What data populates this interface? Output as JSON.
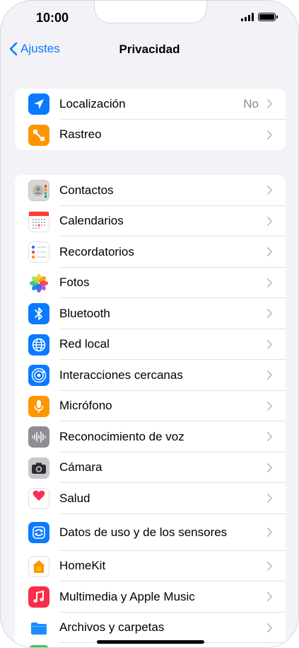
{
  "status_bar": {
    "time": "10:00"
  },
  "nav": {
    "back_label": "Ajustes",
    "title": "Privacidad"
  },
  "colors": {
    "accent": "#0a7aff",
    "background": "#f2f2f7"
  },
  "groups": [
    {
      "items": [
        {
          "label": "Localización",
          "value": "No",
          "icon": "location-arrow-icon",
          "icon_color": "#0a7aff"
        },
        {
          "label": "Rastreo",
          "icon": "tracking-icon",
          "icon_color": "#ff9500"
        }
      ]
    },
    {
      "items": [
        {
          "label": "Contactos",
          "icon": "contacts-icon"
        },
        {
          "label": "Calendarios",
          "icon": "calendar-icon"
        },
        {
          "label": "Recordatorios",
          "icon": "reminders-icon"
        },
        {
          "label": "Fotos",
          "icon": "photos-icon"
        },
        {
          "label": "Bluetooth",
          "icon": "bluetooth-icon",
          "icon_color": "#0a7aff"
        },
        {
          "label": "Red local",
          "icon": "globe-icon",
          "icon_color": "#0a7aff"
        },
        {
          "label": "Interacciones cercanas",
          "icon": "nearby-interactions-icon",
          "icon_color": "#0a7aff"
        },
        {
          "label": "Micrófono",
          "icon": "microphone-icon",
          "icon_color": "#ff9500"
        },
        {
          "label": "Reconocimiento de voz",
          "icon": "waveform-icon",
          "icon_color": "#8e8e93"
        },
        {
          "label": "Cámara",
          "icon": "camera-icon",
          "icon_color": "#8e8e93"
        },
        {
          "label": "Salud",
          "icon": "health-heart-icon",
          "icon_color": "#ff2d55"
        },
        {
          "label": "Datos de uso y de los sensores",
          "icon": "sensor-data-icon",
          "icon_color": "#0a7aff"
        },
        {
          "label": "HomeKit",
          "icon": "home-icon",
          "icon_color": "#ff9500"
        },
        {
          "label": "Multimedia y Apple Music",
          "icon": "music-note-icon",
          "icon_color": "#fa2d48"
        },
        {
          "label": "Archivos y carpetas",
          "icon": "folder-icon",
          "icon_color": "#1a8cff"
        }
      ]
    }
  ]
}
